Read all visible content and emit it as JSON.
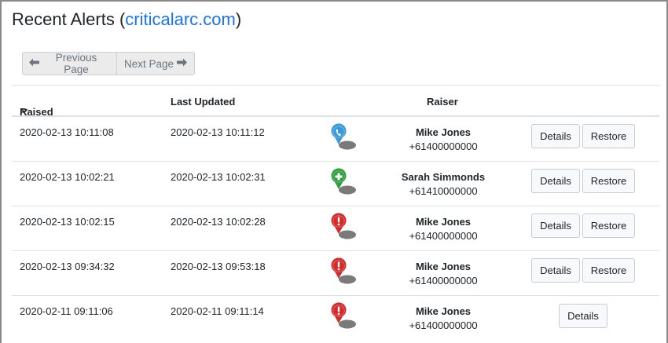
{
  "header": {
    "title_prefix": "Recent Alerts (",
    "title_link": "criticalarc.com",
    "title_suffix": ")"
  },
  "pager": {
    "previous_label": "Previous Page",
    "next_label": "Next Page"
  },
  "table": {
    "columns": {
      "raised": "Raised",
      "last_updated": "Last Updated",
      "raiser": "Raiser"
    },
    "rows": [
      {
        "raised": "2020-02-13 10:11:08",
        "last_updated": "2020-02-13 10:11:12",
        "icon": "phone-icon",
        "icon_color": "#3a9ad9",
        "name": "Mike Jones",
        "phone": "+61400000000",
        "details": "Details",
        "restore": "Restore"
      },
      {
        "raised": "2020-02-13 10:02:21",
        "last_updated": "2020-02-13 10:02:31",
        "icon": "medical-icon",
        "icon_color": "#2e9e3e",
        "name": "Sarah Simmonds",
        "phone": "+61410000000",
        "details": "Details",
        "restore": "Restore"
      },
      {
        "raised": "2020-02-13 10:02:15",
        "last_updated": "2020-02-13 10:02:28",
        "icon": "alert-icon",
        "icon_color": "#d42a2a",
        "name": "Mike Jones",
        "phone": "+61400000000",
        "details": "Details",
        "restore": "Restore"
      },
      {
        "raised": "2020-02-13 09:34:32",
        "last_updated": "2020-02-13 09:53:18",
        "icon": "alert-icon",
        "icon_color": "#d42a2a",
        "name": "Mike Jones",
        "phone": "+61400000000",
        "details": "Details",
        "restore": "Restore"
      },
      {
        "raised": "2020-02-11 09:11:06",
        "last_updated": "2020-02-11 09:11:14",
        "icon": "alert-icon",
        "icon_color": "#d42a2a",
        "name": "Mike Jones",
        "phone": "+61400000000",
        "details": "Details"
      }
    ]
  }
}
